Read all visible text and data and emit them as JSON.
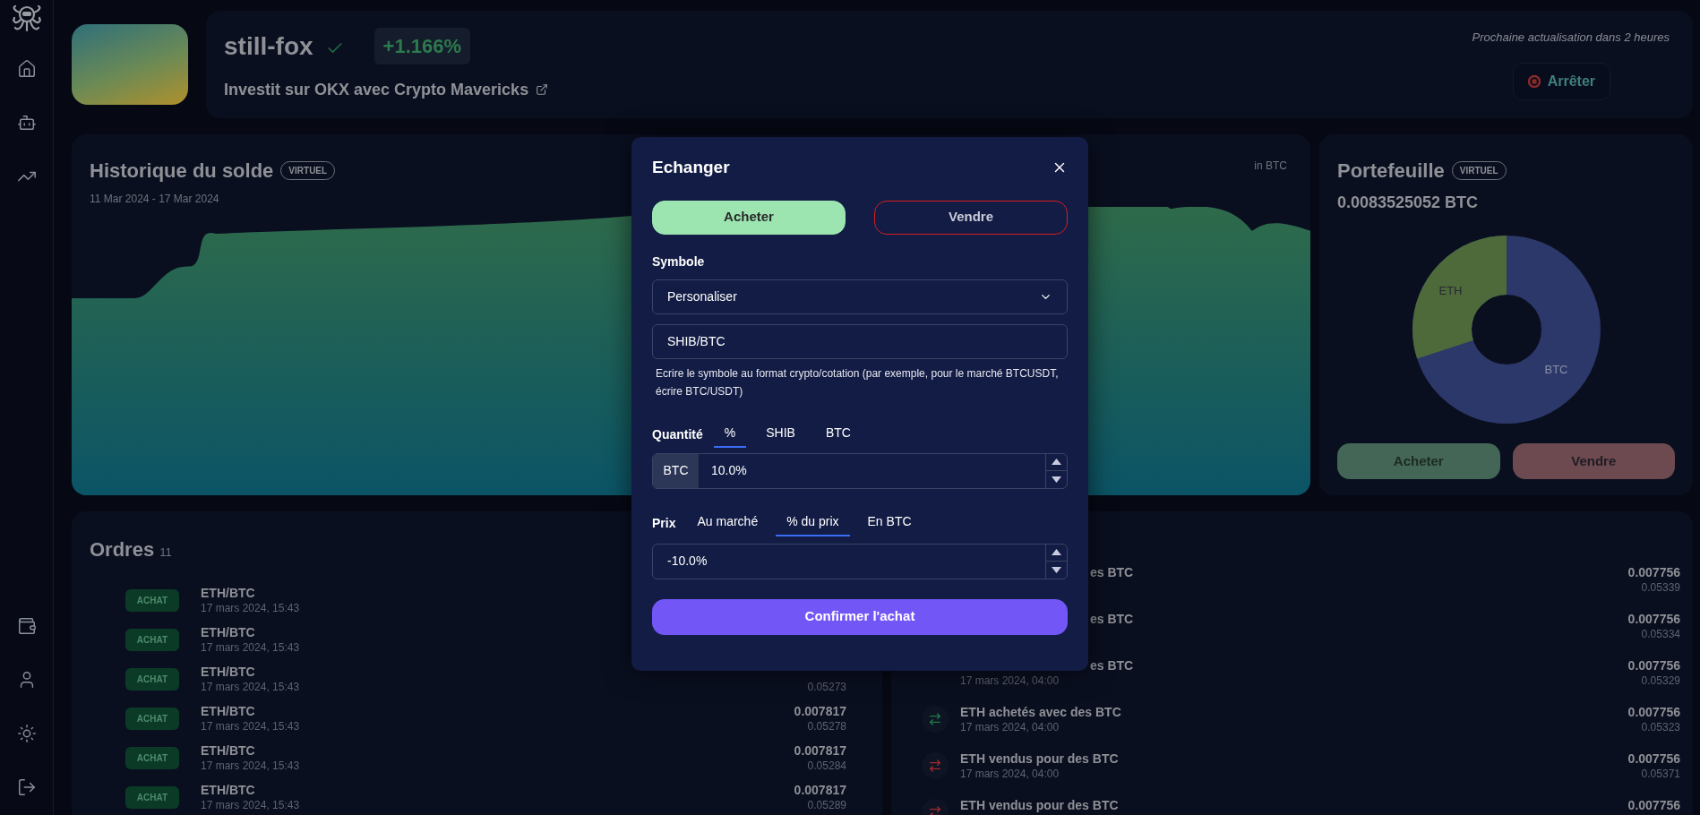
{
  "header": {
    "name": "still-fox",
    "verified": true,
    "change": "+1.166%",
    "subtitle": "Investit sur OKX avec Crypto Mavericks",
    "next_update": "Prochaine actualisation dans 2 heures",
    "stop_button": "Arrêter"
  },
  "balance_history": {
    "title": "Historique du solde",
    "badge": "VIRTUEL",
    "date_range": "11 Mar 2024 - 17 Mar 2024",
    "unit": "in BTC"
  },
  "portfolio": {
    "title": "Portefeuille",
    "badge": "VIRTUEL",
    "total": "0.0083525052 BTC",
    "donut_labels": [
      "ETH",
      "BTC"
    ],
    "buy_button": "Acheter",
    "sell_button": "Vendre"
  },
  "orders": {
    "title": "Ordres",
    "count": "11",
    "rows": [
      {
        "side": "ACHAT",
        "pair": "ETH/BTC",
        "time": "17 mars 2024, 15:43"
      },
      {
        "side": "ACHAT",
        "pair": "ETH/BTC",
        "time": "17 mars 2024, 15:43"
      },
      {
        "side": "ACHAT",
        "pair": "ETH/BTC",
        "time": "17 mars 2024, 15:43",
        "price": "0.05273"
      },
      {
        "side": "ACHAT",
        "pair": "ETH/BTC",
        "time": "17 mars 2024, 15:43",
        "amount": "0.007817",
        "price": "0.05278"
      },
      {
        "side": "ACHAT",
        "pair": "ETH/BTC",
        "time": "17 mars 2024, 15:43",
        "amount": "0.007817",
        "price": "0.05284"
      },
      {
        "side": "ACHAT",
        "pair": "ETH/BTC",
        "time": "17 mars 2024, 15:43",
        "amount": "0.007817",
        "price": "0.05289"
      }
    ]
  },
  "transactions": {
    "rows": [
      {
        "title": "es BTC",
        "covered": true,
        "amount": "0.007756",
        "price": "0.05339"
      },
      {
        "title": "es BTC",
        "covered": true,
        "amount": "0.007756",
        "price": "0.05334"
      },
      {
        "title": "es BTC",
        "covered": true,
        "time": "17 mars 2024, 04:00",
        "amount": "0.007756",
        "price": "0.05329"
      },
      {
        "kind": "buy",
        "title": "ETH achetés avec des BTC",
        "covered": false,
        "time": "17 mars 2024, 04:00",
        "amount": "0.007756",
        "price": "0.05323"
      },
      {
        "kind": "sell",
        "title": "ETH vendus pour des BTC",
        "covered": false,
        "time": "17 mars 2024, 04:00",
        "amount": "0.007756",
        "price": "0.05371"
      },
      {
        "kind": "sell",
        "title": "ETH vendus pour des BTC",
        "covered": false,
        "amount": "0.007756"
      }
    ]
  },
  "modal": {
    "title": "Echanger",
    "sides": [
      {
        "label": "Acheter",
        "kind": "buy",
        "selected": true
      },
      {
        "label": "Vendre",
        "kind": "sell",
        "selected": false
      }
    ],
    "symbol_label": "Symbole",
    "symbol_select": "Personaliser",
    "symbol_value": "SHIB/BTC",
    "symbol_help": "Ecrire le symbole au format crypto/cotation (par exemple, pour le marché BTCUSDT, écrire BTC/USDT)",
    "quantity_label": "Quantité",
    "quantity_tabs": [
      {
        "label": "%",
        "selected": true
      },
      {
        "label": "SHIB",
        "selected": false
      },
      {
        "label": "BTC",
        "selected": false
      }
    ],
    "quantity_prefix": "BTC",
    "quantity_value": "10.0%",
    "price_label": "Prix",
    "price_tabs": [
      {
        "label": "Au marché",
        "selected": false
      },
      {
        "label": "% du prix",
        "selected": true
      },
      {
        "label": "En BTC",
        "selected": false
      }
    ],
    "price_value": "-10.0%",
    "confirm_button": "Confirmer l'achat"
  }
}
